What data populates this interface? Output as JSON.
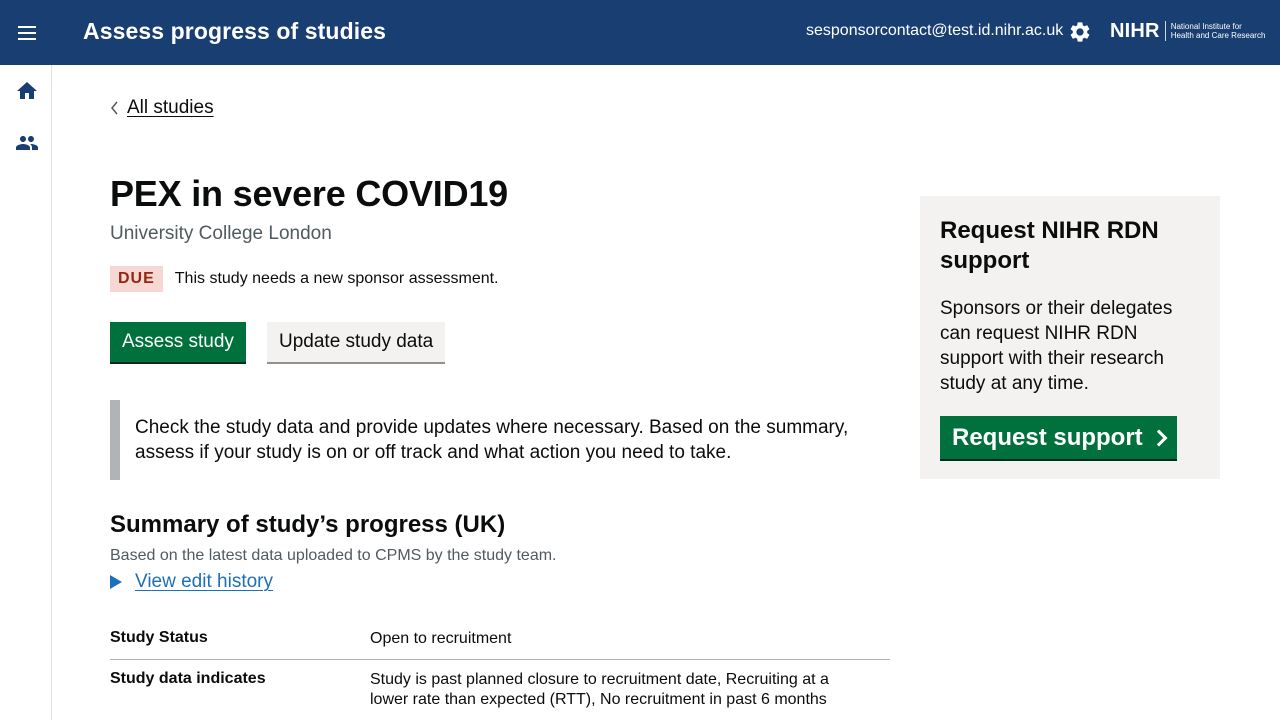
{
  "header": {
    "app_title": "Assess progress of studies",
    "user_email": "sesponsorcontact@test.id.nihr.ac.uk",
    "logo": {
      "mark": "NIHR",
      "line1": "National Institute for",
      "line2": "Health and Care Research"
    },
    "menu_icon": "hamburger-menu-icon",
    "settings_icon": "gear-icon",
    "background_color": "#193e72"
  },
  "sidenav": {
    "items": [
      {
        "icon": "home-icon"
      },
      {
        "icon": "users-icon"
      }
    ]
  },
  "breadcrumb": {
    "back_label": "All studies"
  },
  "study": {
    "title": "PEX in severe COVID19",
    "sponsor": "University College London",
    "status_tag": "DUE",
    "status_text": "This study needs a new sponsor assessment."
  },
  "actions": {
    "primary_label": "Assess study",
    "secondary_label": "Update study data"
  },
  "inset_text": "Check the study data and provide updates where necessary. Based on the summary, assess if your study is on or off track and what action you need to take.",
  "summary": {
    "heading": "Summary of study’s progress (UK)",
    "caption": "Based on the latest data uploaded to CPMS by the study team.",
    "details_label": "View edit history",
    "rows": [
      {
        "key": "Study Status",
        "value": "Open to recruitment"
      },
      {
        "key": "Study data indicates",
        "value": "Study is past planned closure to recruitment date, Recruiting at a lower rate than expected (RTT), No recruitment in past 6 months"
      }
    ]
  },
  "sidebar": {
    "title": "Request NIHR RDN support",
    "body": "Sponsors or their delegates can request NIHR RDN support with their research study at any time.",
    "button_label": "Request support"
  },
  "colors": {
    "primary_green": "#00703c",
    "link_blue": "#1d70b8",
    "due_tag_bg": "#f6d7d2",
    "due_tag_text": "#942514"
  }
}
